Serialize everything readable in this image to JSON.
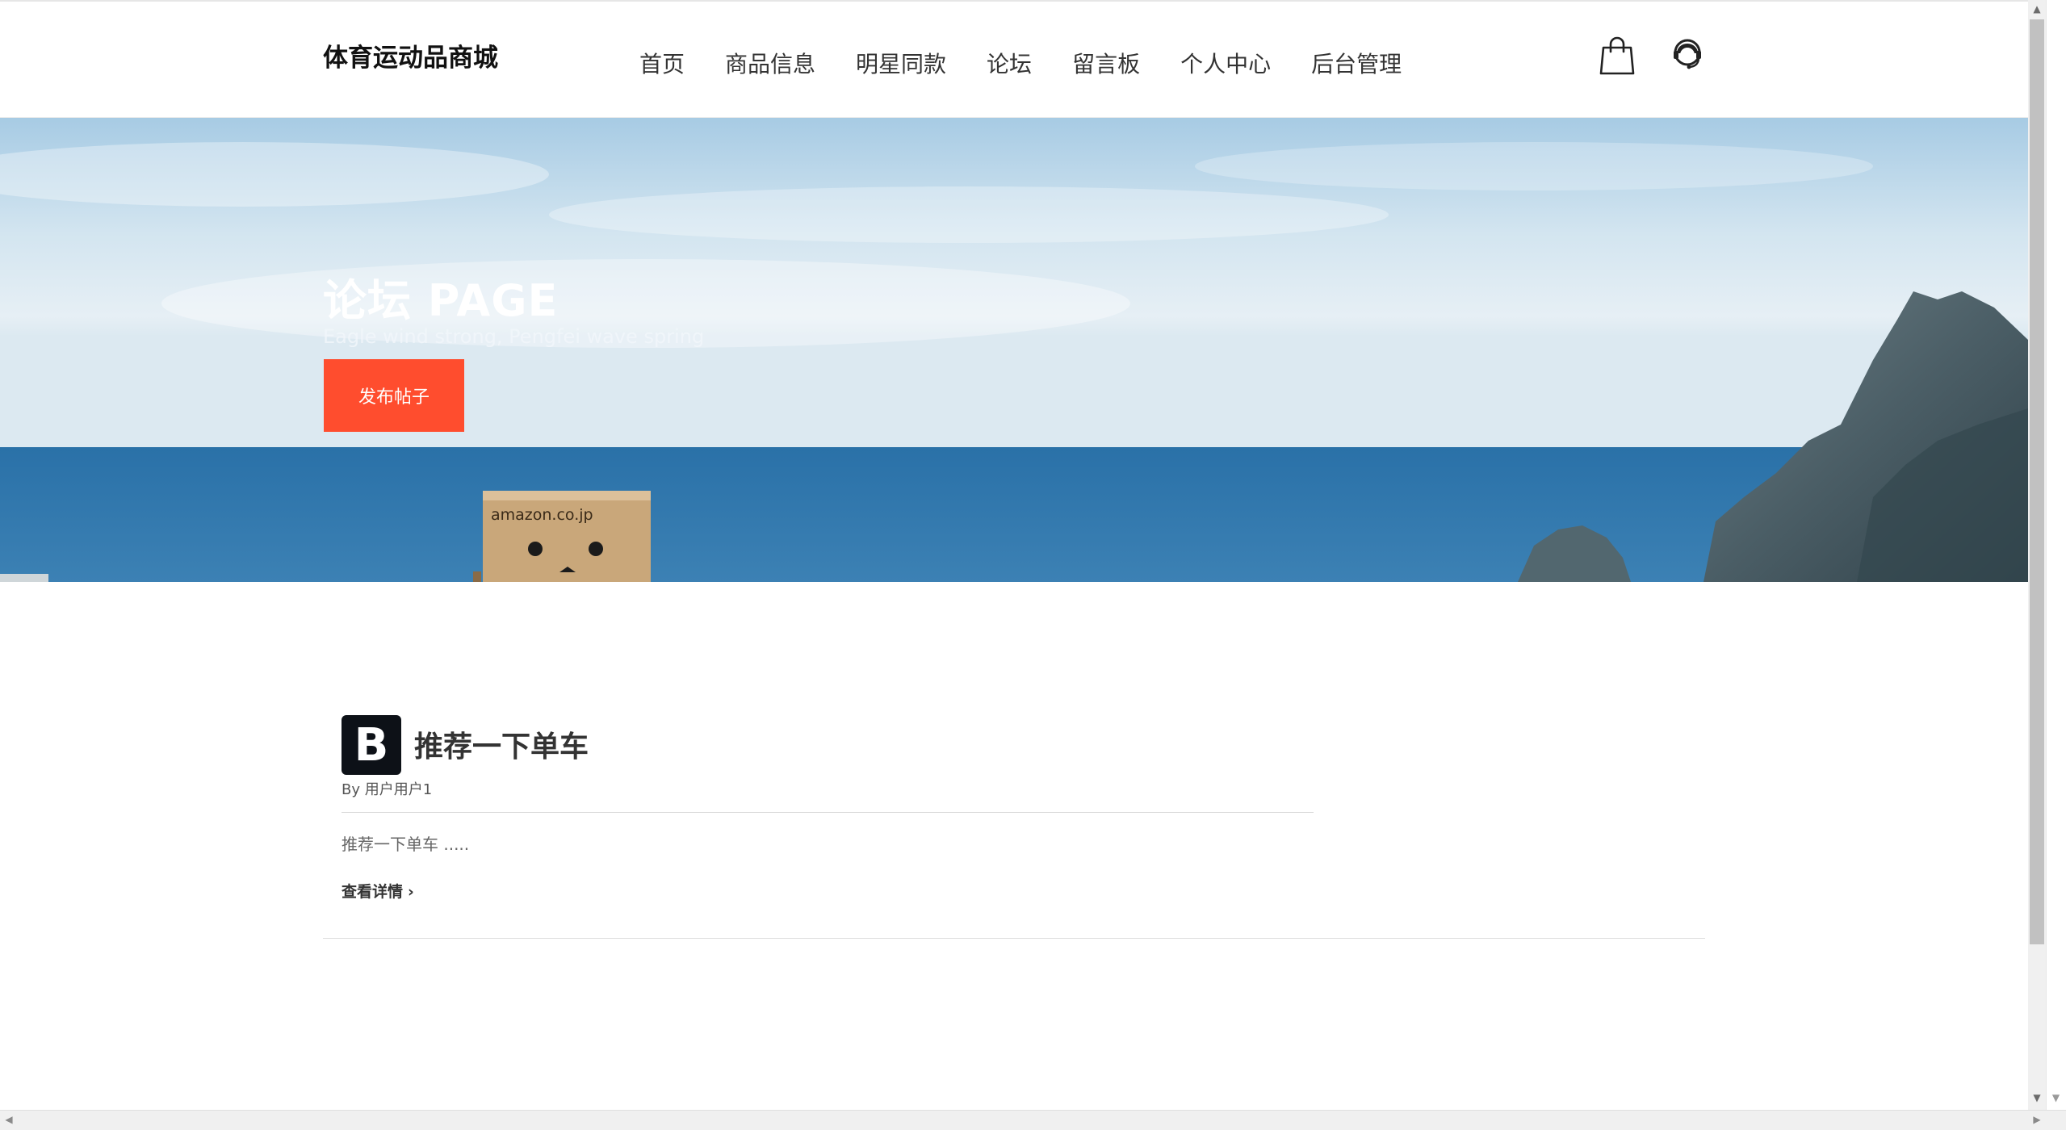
{
  "header": {
    "brand": "体育运动品商城",
    "nav": [
      "首页",
      "商品信息",
      "明星同款",
      "论坛",
      "留言板",
      "个人中心",
      "后台管理"
    ],
    "icons": [
      "cart-icon",
      "customer-service-icon"
    ]
  },
  "hero": {
    "title": "论坛 PAGE",
    "subtitle": "Eagle wind strong, Pengfei wave spring",
    "button": "发布帖子",
    "button_color": "#ff4d2e",
    "box_text": "amazon.co.jp"
  },
  "posts": [
    {
      "avatar_letter": "B",
      "title": "推荐一下单车",
      "author": "By 用户用户1",
      "excerpt": "推荐一下单车 .....",
      "more": "查看详情"
    }
  ],
  "colors": {
    "accent": "#ff4d2e",
    "text_dark": "#333333"
  }
}
